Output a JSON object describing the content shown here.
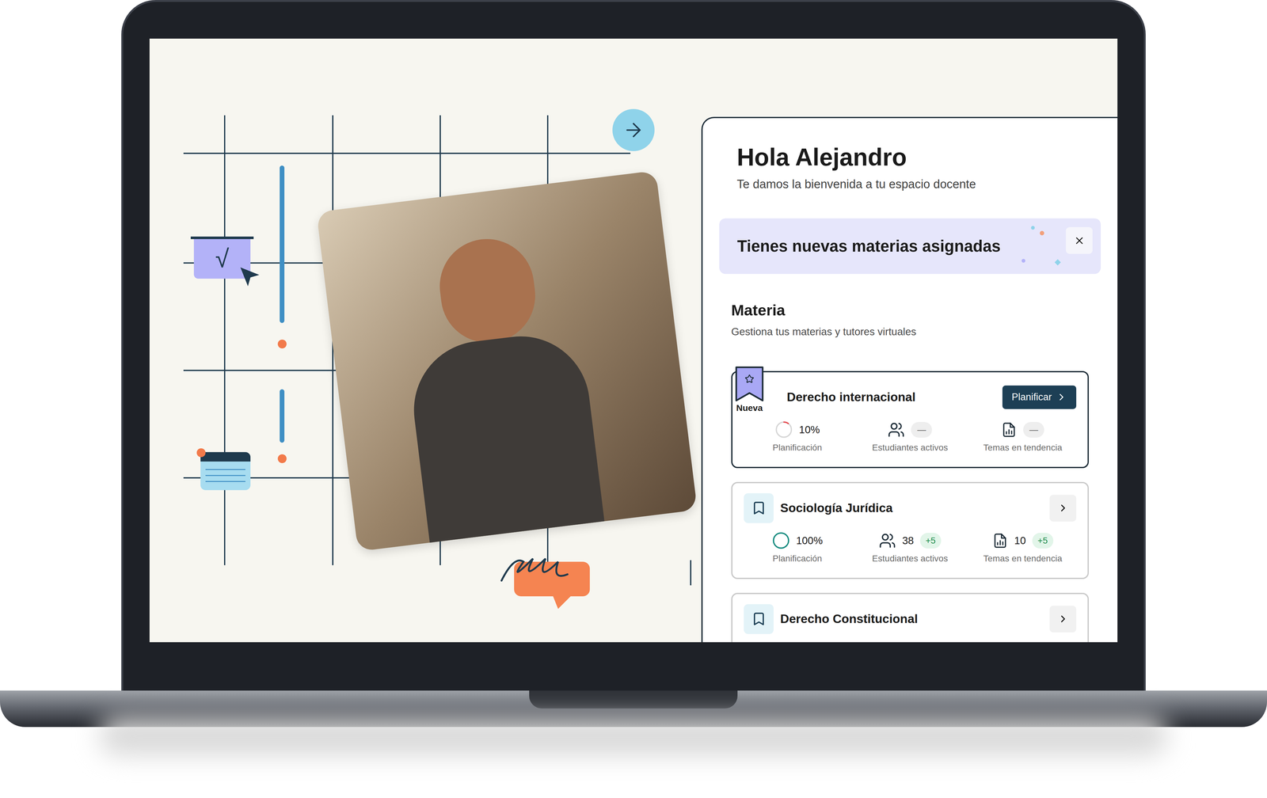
{
  "greeting": {
    "title": "Hola Alejandro",
    "subtitle": "Te damos la bienvenida a tu espacio docente"
  },
  "banner": {
    "text": "Tienes nuevas materias asignadas"
  },
  "section": {
    "title": "Materia",
    "subtitle": "Gestiona tus materias y tutores virtuales"
  },
  "subjects": [
    {
      "name": "Derecho internacional",
      "kind": "new",
      "badge": "Nueva",
      "action": "Planificar",
      "stats": [
        {
          "kind": "progress",
          "value": "10%",
          "level": 0.1,
          "color": "#e5484d",
          "label": "Planificación"
        },
        {
          "kind": "students",
          "value": "",
          "pill": "—",
          "pill_positive": false,
          "label": "Estudiantes activos"
        },
        {
          "kind": "topics",
          "value": "",
          "pill": "—",
          "pill_positive": false,
          "label": "Temas en tendencia"
        }
      ]
    },
    {
      "name": "Sociología Jurídica",
      "kind": "regular",
      "stats": [
        {
          "kind": "progress",
          "value": "100%",
          "level": 1,
          "color": "#0f8a7e",
          "label": "Planificación"
        },
        {
          "kind": "students",
          "value": "38",
          "pill": "+5",
          "pill_positive": true,
          "label": "Estudiantes activos"
        },
        {
          "kind": "topics",
          "value": "10",
          "pill": "+5",
          "pill_positive": true,
          "label": "Temas en tendencia"
        }
      ]
    },
    {
      "name": "Derecho Constitucional",
      "kind": "regular",
      "stats": []
    }
  ],
  "illustration": {
    "symbol": "√"
  }
}
